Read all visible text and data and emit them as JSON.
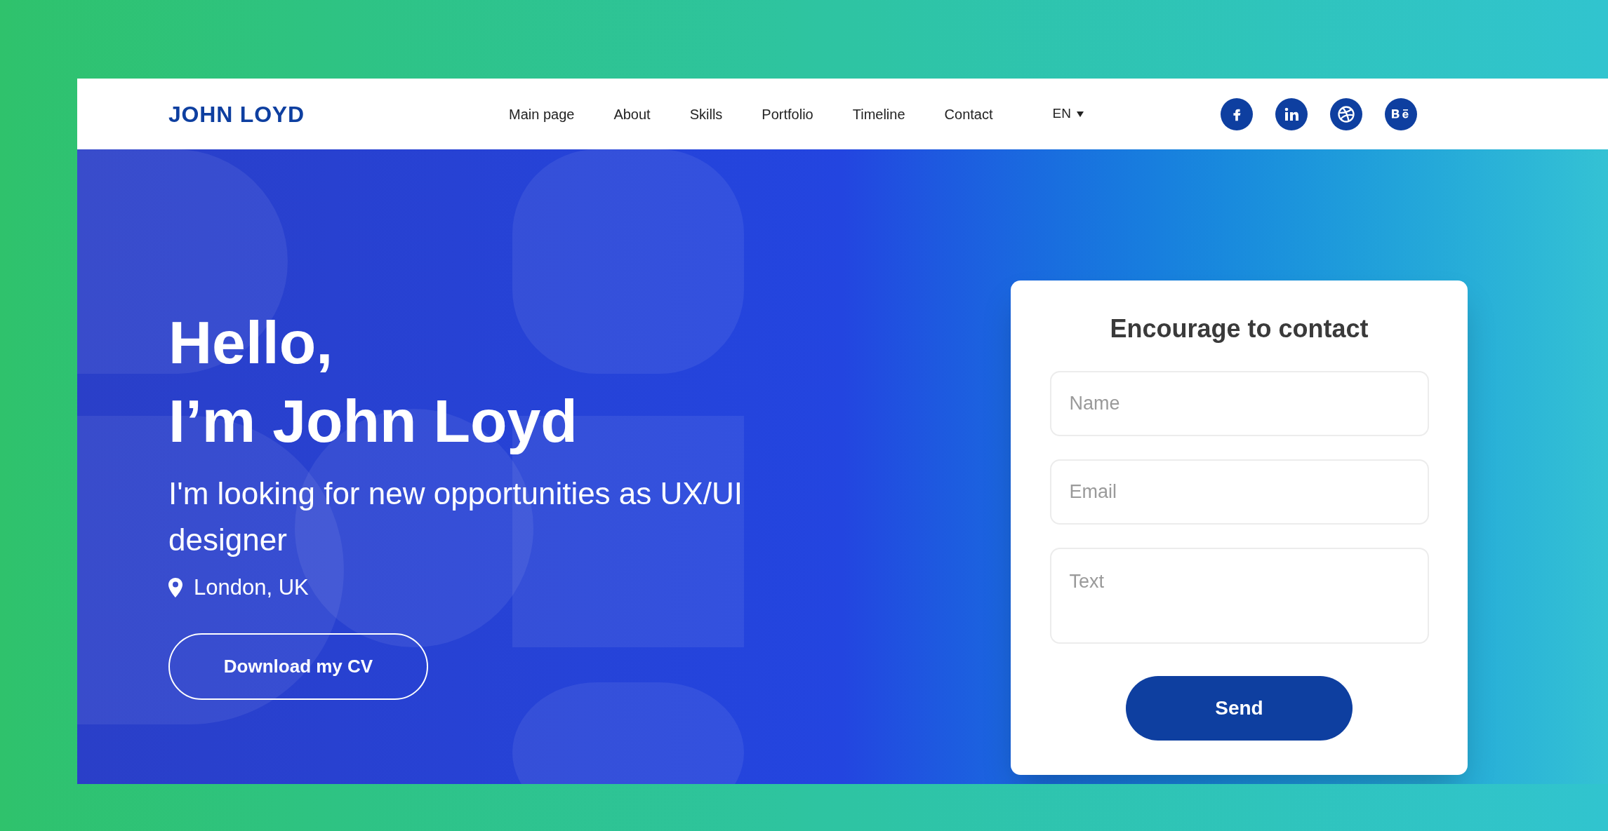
{
  "header": {
    "logo": "JOHN LOYD",
    "nav": [
      "Main page",
      "About",
      "Skills",
      "Portfolio",
      "Timeline",
      "Contact"
    ],
    "language": "EN",
    "social": [
      {
        "kind": "facebook"
      },
      {
        "kind": "linkedin"
      },
      {
        "kind": "dribbble"
      },
      {
        "kind": "behance"
      }
    ]
  },
  "hero": {
    "greeting": "Hello,",
    "name_line": "I’m John Loyd",
    "tagline": "I'm looking for new opportunities as UX/UI designer",
    "location": "London, UK",
    "cv_button": "Download my CV"
  },
  "contact_form": {
    "title": "Encourage to contact",
    "fields": [
      {
        "kind": "input",
        "placeholder": "Name"
      },
      {
        "kind": "input",
        "placeholder": "Email"
      },
      {
        "kind": "textarea",
        "placeholder": "Text"
      }
    ],
    "submit": "Send"
  }
}
